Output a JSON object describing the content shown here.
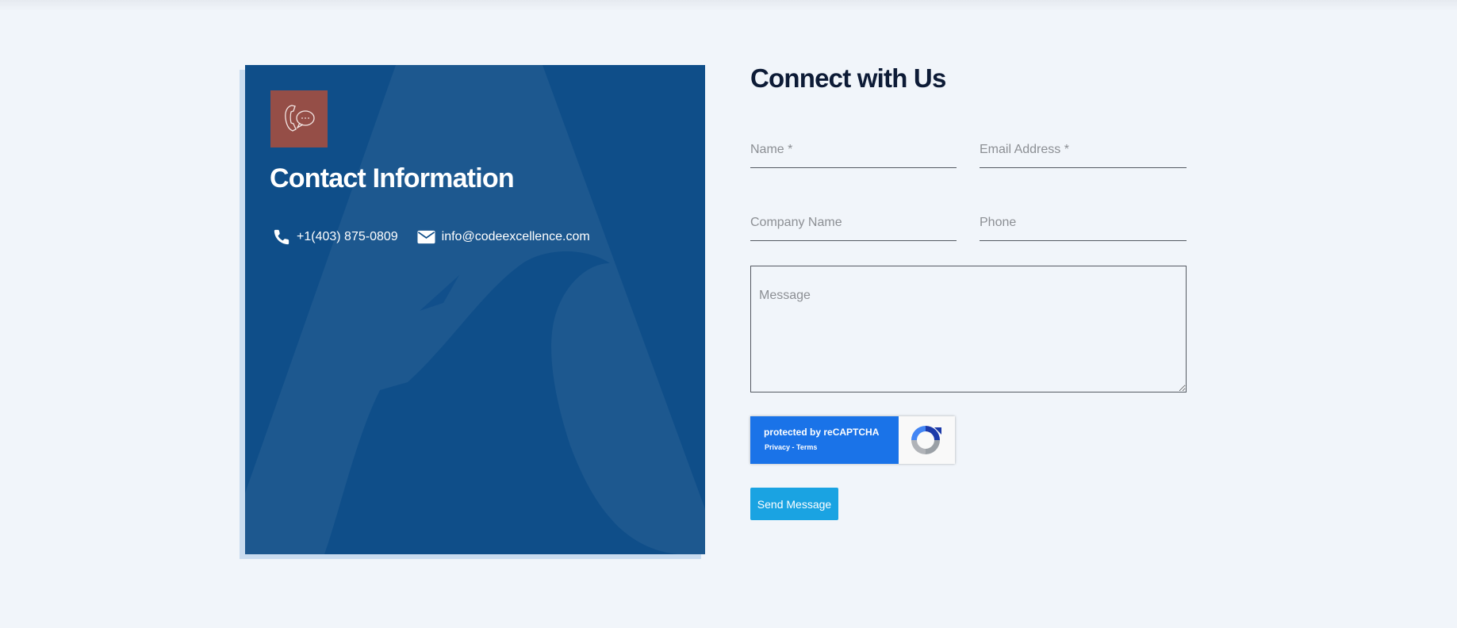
{
  "contact": {
    "title": "Contact Information",
    "phone": "+1(403) 875-0809",
    "email": "info@codeexcellence.com",
    "icon_box_color": "#954e47",
    "card_color": "#0f4e89",
    "icons": [
      "phone-chat-icon",
      "phone-icon",
      "envelope-icon"
    ]
  },
  "form": {
    "title": "Connect with Us",
    "name_placeholder": "Name *",
    "email_placeholder": "Email Address *",
    "company_placeholder": "Company Name",
    "phone_placeholder": "Phone",
    "message_placeholder": "Message",
    "recaptcha": {
      "protected_prefix": "protected by ",
      "brand": "reCAPTCHA",
      "privacy": "Privacy",
      "separator": " - ",
      "terms": "Terms"
    },
    "submit_label": "Send Message",
    "submit_color": "#1aa3e2"
  }
}
